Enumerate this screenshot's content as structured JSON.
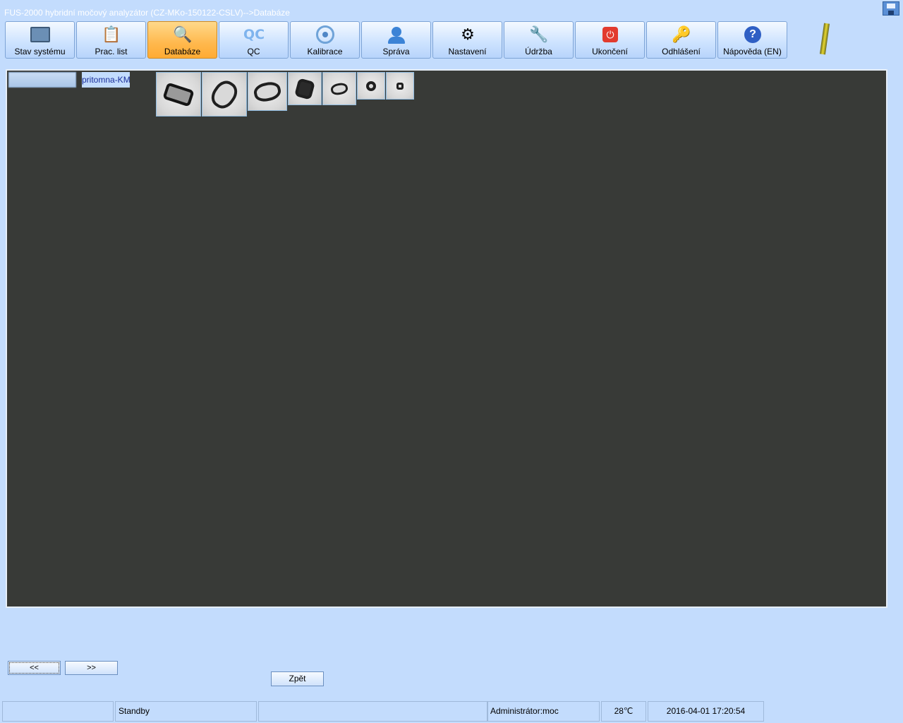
{
  "window": {
    "title": "FUS-2000 hybridní močový analyzátor (CZ-MKo-150122-CSLV)-->Databáze"
  },
  "toolbar": {
    "items": [
      {
        "label": "Stav systému",
        "icon": "monitor-icon"
      },
      {
        "label": "Prac. list",
        "icon": "worklist-icon"
      },
      {
        "label": "Databáze",
        "icon": "magnifier-icon",
        "active": true
      },
      {
        "label": "QC",
        "icon": "qc-icon",
        "glyph": "QC"
      },
      {
        "label": "Kalibrace",
        "icon": "target-icon"
      },
      {
        "label": "Správa",
        "icon": "user-icon"
      },
      {
        "label": "Nastavení",
        "icon": "gears-icon"
      },
      {
        "label": "Údržba",
        "icon": "tools-icon"
      },
      {
        "label": "Ukončení",
        "icon": "power-icon",
        "glyph": "⏻"
      },
      {
        "label": "Odhlášení",
        "icon": "keys-icon"
      },
      {
        "label": "Nápověda (EN)",
        "icon": "help-icon",
        "glyph": "?"
      }
    ],
    "accent_active": "#ffb84d"
  },
  "viewer": {
    "tab_label": "pritomna-KM",
    "thumbnail_count": 7,
    "background": "#383a37"
  },
  "nav": {
    "prev_label": "<<",
    "next_label": ">>",
    "back_label": "Zpět"
  },
  "status": {
    "cell1": "",
    "state": "Standby",
    "cell3": "",
    "user": "Administrátor:moc",
    "temperature": "28℃",
    "datetime": "2016-04-01 17:20:54"
  }
}
